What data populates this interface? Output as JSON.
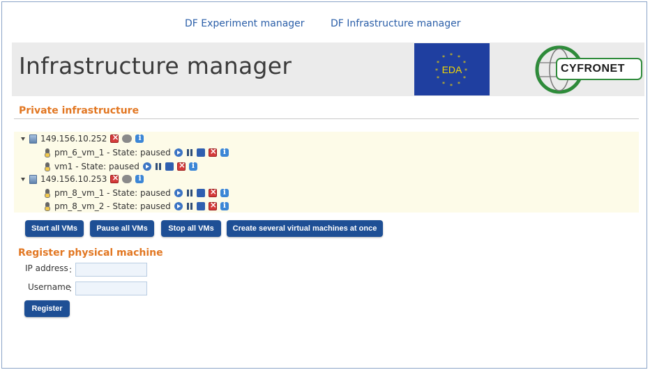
{
  "nav": {
    "experiment_manager": "DF Experiment manager",
    "infrastructure_manager": "DF Infrastructure manager"
  },
  "header": {
    "title": "Infrastructure manager",
    "eda_logo_text": "EDA",
    "cyfronet_logo_text": "CYFRONET"
  },
  "private_infra": {
    "title": "Private infrastructure",
    "machines": [
      {
        "host": "149.156.10.252",
        "vms": [
          {
            "label": "pm_6_vm_1 - State: paused"
          },
          {
            "label": "vm1 - State: paused"
          }
        ]
      },
      {
        "host": "149.156.10.253",
        "vms": [
          {
            "label": "pm_8_vm_1 - State: paused"
          },
          {
            "label": "pm_8_vm_2 - State: paused"
          }
        ]
      }
    ]
  },
  "actions": {
    "start_all": "Start all VMs",
    "pause_all": "Pause all VMs",
    "stop_all": "Stop all VMs",
    "create_several": "Create several virtual machines at once"
  },
  "register": {
    "title": "Register physical machine",
    "ip_label": "IP address",
    "username_label": "Username",
    "colon": ":",
    "ip_value": "",
    "username_value": "",
    "submit": "Register"
  },
  "colors": {
    "accent": "#e27722",
    "button": "#1e4f95",
    "link": "#2a5ea8"
  }
}
